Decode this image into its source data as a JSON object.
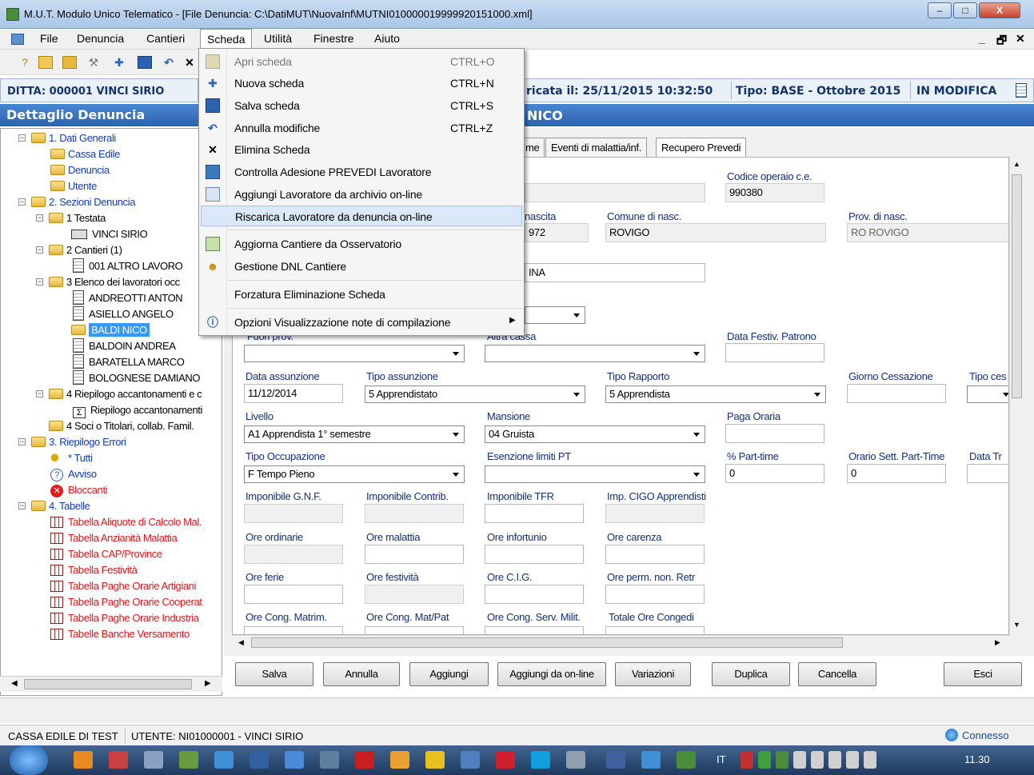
{
  "window": {
    "title": "M.U.T. Modulo Unico Telematico - [File Denuncia: C:\\DatiMUT\\NuovaInf\\MUTNI01000001999992015100 0.xml]",
    "title_text": "M.U.T. Modulo Unico Telematico - [File Denuncia: C:\\DatiMUT\\NuovaInf\\MUTNI010000019999920151000.xml]",
    "minimize": "–",
    "maximize": "□",
    "close": "X"
  },
  "menubar": {
    "items": [
      "File",
      "Denuncia",
      "Cantieri",
      "Scheda",
      "Utilità",
      "Finestre",
      "Aiuto"
    ],
    "mdi_min": "_",
    "mdi_restore": "🗗",
    "mdi_close": "✕"
  },
  "ditta": "DITTA: 000001 VINCI SIRIO",
  "header_right": {
    "caricata": "ricata il: 25/11/2015 10:32:50",
    "tipo": "Tipo: BASE - Ottobre 2015",
    "stato": "IN MODIFICA"
  },
  "section_title": "Dettaglio Denuncia",
  "blue_bar_text": "NICO",
  "tree": {
    "dati_generali": "1. Dati Generali",
    "cassa_edile": "Cassa Edile",
    "denuncia": "Denuncia",
    "utente": "Utente",
    "sezioni": "2. Sezioni Denuncia",
    "testata": "1 Testata",
    "vinci": "VINCI SIRIO",
    "cantieri": "2 Cantieri (1)",
    "altro_lavoro": "001 ALTRO LAVORO",
    "elenco": "3 Elenco dei lavoratori occ",
    "lav1": "ANDREOTTI ANTON",
    "lav2": "ASIELLO ANGELO",
    "lav3": "BALDI NICO",
    "lav4": "BALDOIN ANDREA",
    "lav5": "BARATELLA MARCO",
    "lav6": "BOLOGNESE DAMIANO",
    "riepilogo_acc": "4 Riepilogo accantonamenti e c",
    "riepilogo_acc2": "Riepilogo accantonamenti",
    "soci": "4 Soci o Titolari, collab. Famil.",
    "riepilogo_err": "3. Riepilogo Errori",
    "tutti": "* Tutti",
    "avviso": "Avviso",
    "bloccanti": "Bloccanti",
    "tabelle": "4. Tabelle",
    "t1": "Tabella Aliquote di Calcolo Mal.",
    "t2": "Tabella Anzianità Malattia",
    "t3": "Tabella CAP/Province",
    "t4": "Tabella Festività",
    "t5": "Tabella Paghe Orarie Artigiani",
    "t6": "Tabella Paghe Orarie Cooperat",
    "t7": "Tabella Paghe Orarie Industria",
    "t8": "Tabelle Banche Versamento"
  },
  "tabs": {
    "t1": "me",
    "t2": "Eventi di malattia/inf.",
    "t3": "Recupero Prevedi"
  },
  "form": {
    "codice_operaio_label": "Codice operaio c.e.",
    "codice_operaio": "990380",
    "nascita_label": "nascita",
    "nascita": "972",
    "comune_label": "Comune di nasc.",
    "comune": "ROVIGO",
    "prov_label": "Prov. di nasc.",
    "prov": "RO ROVIGO",
    "indirizzo_fragment": "INA",
    "fuori_prov_label": "Fuori prov.",
    "altra_cassa_label": "Altra cassa",
    "data_festiv_label": "Data Festiv. Patrono",
    "data_assunzione_label": "Data assunzione",
    "data_assunzione": "11/12/2014",
    "tipo_assunzione_label": "Tipo assunzione",
    "tipo_assunzione": "5 Apprendistato",
    "tipo_rapporto_label": "Tipo Rapporto",
    "tipo_rapporto": "5 Apprendista",
    "giorno_cess_label": "Giorno Cessazione",
    "tipo_cess_label": "Tipo ces",
    "livello_label": "Livello",
    "livello": "A1 Apprendista 1° semestre",
    "mansione_label": "Mansione",
    "mansione": "04 Gruista",
    "paga_oraria_label": "Paga Oraria",
    "tipo_occ_label": "Tipo Occupazione",
    "tipo_occ": "F Tempo Pieno",
    "esenzione_label": "Esenzione limiti PT",
    "part_time_label": "% Part-time",
    "part_time": "0",
    "orario_sett_label": "Orario Sett. Part-Time",
    "orario_sett": "0",
    "data_tr_label": "Data Tr",
    "imp_gnf_label": "Imponibile G.N.F.",
    "imp_contrib_label": "Imponibile Contrib.",
    "imp_tfr_label": "Imponibile TFR",
    "imp_cigo_label": "Imp. CIGO Apprendisti",
    "ore_ordinarie_label": "Ore ordinarie",
    "ore_malattia_label": "Ore malattia",
    "ore_infortunio_label": "Ore infortunio",
    "ore_carenza_label": "Ore carenza",
    "ore_ferie_label": "Ore ferie",
    "ore_festivita_label": "Ore festività",
    "ore_cig_label": "Ore C.I.G.",
    "ore_perm_label": "Ore perm. non. Retr",
    "ore_cong_matrim_label": "Ore Cong. Matrim.",
    "ore_cong_matpat_label": "Ore Cong. Mat/Pat",
    "ore_cong_serv_label": "Ore Cong. Serv. Milit.",
    "totale_cong_label": "Totale Ore Congedi"
  },
  "buttons": {
    "salva": "Salva",
    "annulla": "Annulla",
    "aggiungi": "Aggiungi",
    "aggiungi_online": "Aggiungi da on-line",
    "variazioni": "Variazioni",
    "duplica": "Duplica",
    "cancella": "Cancella",
    "esci": "Esci"
  },
  "status": {
    "left": "CASSA EDILE DI TEST",
    "utente": "UTENTE: NI01000001 - VINCI SIRIO",
    "connesso": "Connesso"
  },
  "taskbar": {
    "lang": "IT",
    "clock": "11.30"
  },
  "menu": {
    "items": [
      {
        "label": "Apri scheda",
        "shortcut": "CTRL+O"
      },
      {
        "label": "Nuova scheda",
        "shortcut": "CTRL+N"
      },
      {
        "label": "Salva scheda",
        "shortcut": "CTRL+S"
      },
      {
        "label": "Annulla modifiche",
        "shortcut": "CTRL+Z"
      },
      {
        "label": "Elimina Scheda",
        "shortcut": ""
      },
      {
        "label": "Controlla Adesione PREVEDI Lavoratore",
        "shortcut": ""
      },
      {
        "label": "Aggiungi Lavoratore da archivio on-line",
        "shortcut": ""
      },
      {
        "label": "Riscarica Lavoratore da denuncia on-line",
        "shortcut": ""
      },
      {
        "label": "Aggiorna Cantiere da Osservatorio",
        "shortcut": ""
      },
      {
        "label": "Gestione DNL Cantiere",
        "shortcut": ""
      },
      {
        "label": "Forzatura Eliminazione Scheda",
        "shortcut": ""
      },
      {
        "label": "Opzioni Visualizzazione note di compilazione",
        "shortcut": ""
      }
    ]
  }
}
